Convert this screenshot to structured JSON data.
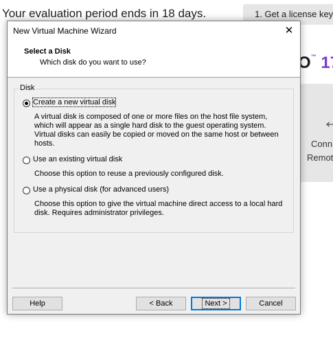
{
  "background": {
    "evaluation_notice": "Your evaluation period ends in 18 days.",
    "license_button": "1. Get a license key",
    "logo_fragment": "O",
    "logo_version": "17",
    "tile_label_line1": "Conn",
    "tile_label_line2": "Remot",
    "tile_icon": "arrow-left-icon"
  },
  "dialog": {
    "title": "New Virtual Machine Wizard",
    "close_glyph": "✕",
    "header_title": "Select a Disk",
    "header_subtitle": "Which disk do you want to use?",
    "group_label": "Disk",
    "options": [
      {
        "label": "Create a new virtual disk",
        "selected": true,
        "description": "A virtual disk is composed of one or more files on the host file system, which will appear as a single hard disk to the guest operating system. Virtual disks can easily be copied or moved on the same host or between hosts."
      },
      {
        "label": "Use an existing virtual disk",
        "selected": false,
        "description": "Choose this option to reuse a previously configured disk."
      },
      {
        "label": "Use a physical disk (for advanced users)",
        "selected": false,
        "description": "Choose this option to give the virtual machine direct access to a local hard disk. Requires administrator privileges."
      }
    ],
    "buttons": {
      "help": "Help",
      "back": "< Back",
      "next": "Next >",
      "cancel": "Cancel"
    }
  }
}
